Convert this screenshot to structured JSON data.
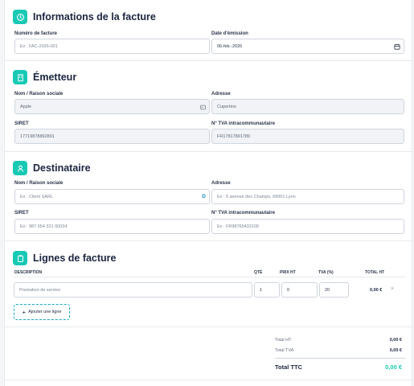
{
  "sections": {
    "invoice": {
      "title": "Informations de la facture"
    },
    "issuer": {
      "title": "Émetteur"
    },
    "recipient": {
      "title": "Destinataire"
    },
    "lines": {
      "title": "Lignes de facture"
    }
  },
  "invoice": {
    "number_label": "Numéro de facture",
    "number_placeholder": "Ex : FAC-2026-001",
    "date_label": "Date d'émission",
    "date_value": "06-feb.-2026"
  },
  "issuer": {
    "name_label": "Nom / Raison sociale",
    "name_value": "Apple",
    "address_label": "Adresse",
    "address_value": "Cupertino",
    "siret_label": "SIRET",
    "siret_value": "17719878892891",
    "vat_label": "N° TVA intracommunautaire",
    "vat_value": "FR17817891789"
  },
  "recipient": {
    "name_label": "Nom / Raison sociale",
    "name_placeholder": "Ex : Client SARL",
    "name_suffix": "D",
    "address_label": "Adresse",
    "address_placeholder": "Ex : 5 avenue des Champs, 69001 Lyon",
    "siret_label": "SIRET",
    "siret_placeholder": "Ex : 987 654 321 00034",
    "vat_label": "N° TVA intracommunautaire",
    "vat_placeholder": "Ex : FR98765432109"
  },
  "lines": {
    "headers": {
      "description": "DESCRIPTION",
      "qty": "QTÉ",
      "price": "PRIX HT",
      "vat": "TVA (%)",
      "total": "TOTAL HT"
    },
    "rows": [
      {
        "description_placeholder": "Prestation de service",
        "qty": "1",
        "price": "0",
        "vat": "20",
        "total": "0,00 €",
        "remove": "×"
      }
    ],
    "add_label": "Ajouter une ligne",
    "add_icon": "+"
  },
  "totals": {
    "ht_label": "Total HT",
    "ht_value": "0,00 €",
    "tva_label": "Total TVA",
    "tva_value": "0,00 €",
    "ttc_label": "Total TTC",
    "ttc_value": "0,00 €"
  },
  "colors": {
    "accent": "#18c9b4",
    "ttc": "#18c9b4"
  }
}
